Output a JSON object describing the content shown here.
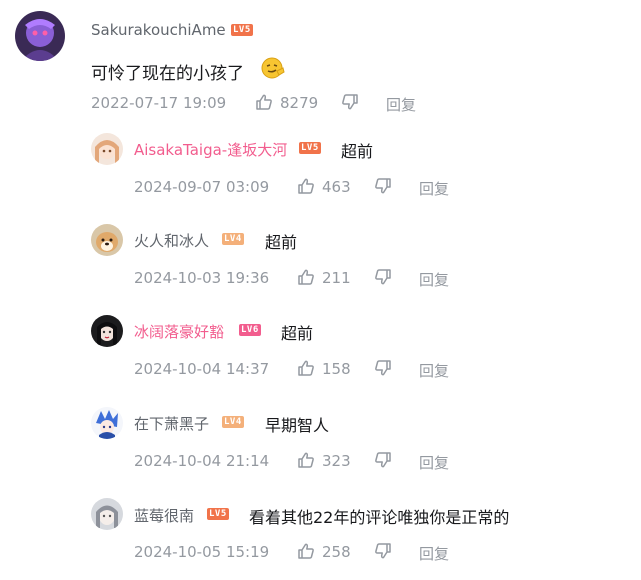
{
  "main": {
    "username": "SakurakouchiAme",
    "level": "LV5",
    "text": "可怜了现在的小孩了",
    "emoji_icon": "smirk-emoji-icon",
    "date": "2022-07-17 19:09",
    "likes": "8279",
    "reply_label": "回复"
  },
  "replies": [
    {
      "username": "AisakaTaiga-逢坂大河",
      "level": "LV5",
      "text": "超前",
      "date": "2024-09-07 03:09",
      "likes": "463",
      "reply_label": "回复",
      "name_color": "#f25d8e"
    },
    {
      "username": "火人和冰人",
      "level": "LV4",
      "text": "超前",
      "date": "2024-10-03 19:36",
      "likes": "211",
      "reply_label": "回复",
      "name_color": "#61666d"
    },
    {
      "username": "冰阔落豪好豁",
      "level": "LV6",
      "text": "超前",
      "date": "2024-10-04 14:37",
      "likes": "158",
      "reply_label": "回复",
      "name_color": "#f25d8e"
    },
    {
      "username": "在下萧黑子",
      "level": "LV4",
      "text": "早期智人",
      "date": "2024-10-04 21:14",
      "likes": "323",
      "reply_label": "回复",
      "name_color": "#61666d"
    },
    {
      "username": "蓝莓很南",
      "level": "LV5",
      "text": "看着其他22年的评论唯独你是正常的",
      "date": "2024-10-05 15:19",
      "likes": "258",
      "reply_label": "回复",
      "name_color": "#61666d"
    }
  ],
  "colors": {
    "meta": "#9499a0",
    "text": "#18191c",
    "pink_name": "#f25d8e",
    "gray_name": "#61666d"
  }
}
